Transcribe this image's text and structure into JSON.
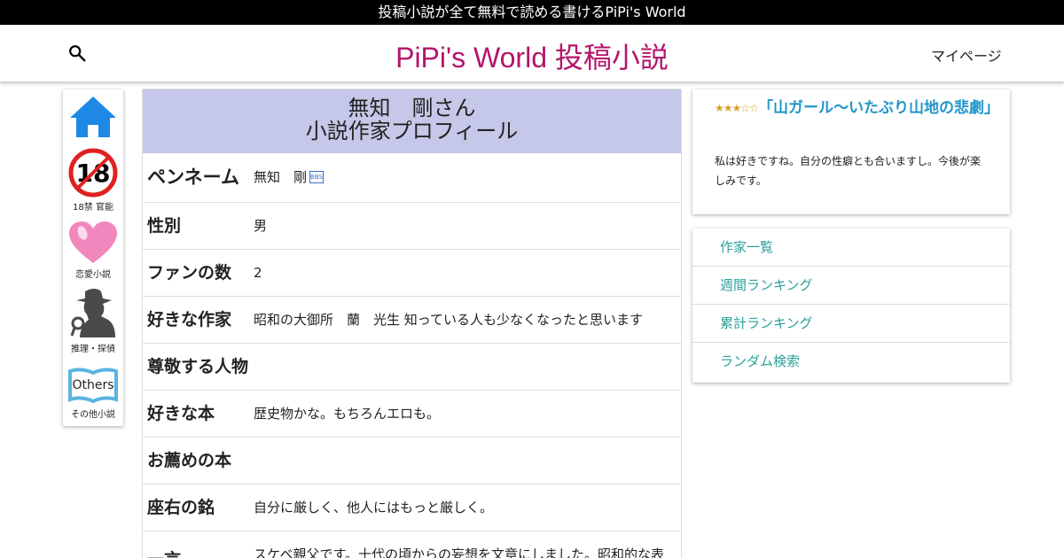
{
  "top_banner": "投稿小説が全て無料で読める書けるPiPi's World",
  "header": {
    "site_title": "PiPi's World 投稿小説",
    "mypage": "マイページ",
    "search_icon": "search-icon"
  },
  "sidebar": {
    "items": [
      {
        "label": "",
        "icon": "home-icon"
      },
      {
        "label": "18禁 官能",
        "icon": "adult-18-icon"
      },
      {
        "label": "恋愛小説",
        "icon": "heart-icon"
      },
      {
        "label": "推理・探偵",
        "icon": "detective-icon"
      },
      {
        "label": "その他小説",
        "icon": "others-icon",
        "icon_text": "Others"
      }
    ]
  },
  "profile": {
    "heading_line1": "無知　剛さん",
    "heading_line2": "小説作家プロフィール",
    "fields": [
      {
        "key": "ペンネーム",
        "value": "無知　剛"
      },
      {
        "key": "性別",
        "value": "男"
      },
      {
        "key": "ファンの数",
        "value": "2"
      },
      {
        "key": "好きな作家",
        "value": "昭和の大御所　蘭　光生 知っている人も少なくなったと思います"
      },
      {
        "key": "尊敬する人物",
        "value": ""
      },
      {
        "key": "好きな本",
        "value": "歴史物かな。もちろんエロも。"
      },
      {
        "key": "お薦めの本",
        "value": ""
      },
      {
        "key": "座右の銘",
        "value": "自分に厳しく、他人にはもっと厳しく。"
      },
      {
        "key": "一言",
        "value": "スケベ親父です。十代の頃からの妄想を文章にしました。昭和的な表"
      }
    ],
    "bbs_label": "BBS"
  },
  "review": {
    "rating": 3,
    "rating_max": 5,
    "title": "「山ガール～いたぶり山地の悲劇」",
    "text": "私は好きですね。自分の性癖とも合いますし。今後が楽しみです。"
  },
  "links": [
    "作家一覧",
    "週間ランキング",
    "累計ランキング",
    "ランダム検索"
  ],
  "colors": {
    "title": "#b5146b",
    "profile_header_bg": "#c5c8e8",
    "link": "#2aa198",
    "review_title": "#2196c9",
    "home_icon": "#1e88e5",
    "heart_icon": "#f088bd"
  }
}
